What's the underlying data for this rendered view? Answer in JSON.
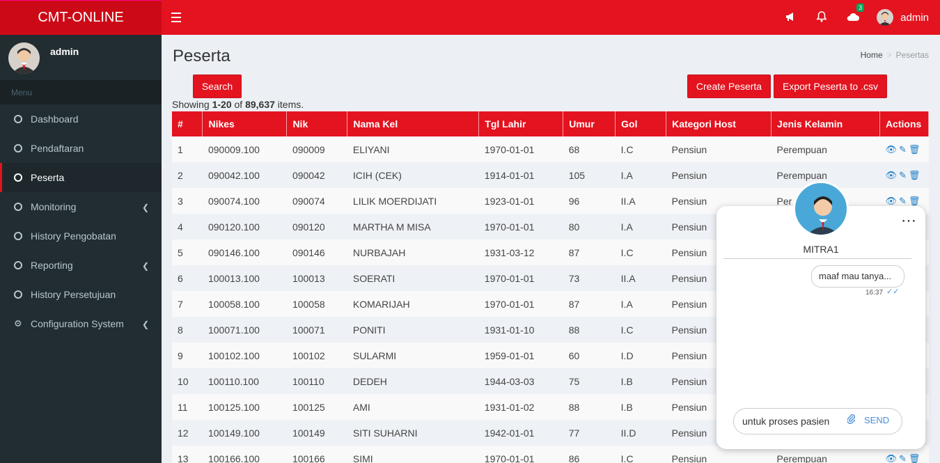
{
  "app": {
    "title": "CMT-ONLINE"
  },
  "topbar": {
    "cloud_badge": "3",
    "username": "admin"
  },
  "sidebar": {
    "username": "admin",
    "menu_header": "Menu",
    "items": [
      {
        "label": "Dashboard"
      },
      {
        "label": "Pendaftaran"
      },
      {
        "label": "Peserta"
      },
      {
        "label": "Monitoring"
      },
      {
        "label": "History Pengobatan"
      },
      {
        "label": "Reporting"
      },
      {
        "label": "History Persetujuan"
      },
      {
        "label": "Configuration System"
      }
    ]
  },
  "page": {
    "title": "Peserta",
    "breadcrumb": {
      "home": "Home",
      "separator": ">",
      "current": "Pesertas"
    },
    "search_button": "Search",
    "create_button": "Create Peserta",
    "export_button": "Export Peserta to .csv",
    "summary": {
      "prefix": "Showing ",
      "range": "1-20",
      "mid": " of ",
      "total": "89,637",
      "suffix": " items."
    }
  },
  "table": {
    "headers": [
      "#",
      "Nikes",
      "Nik",
      "Nama Kel",
      "Tgl Lahir",
      "Umur",
      "Gol",
      "Kategori Host",
      "Jenis Kelamin",
      "Actions"
    ],
    "rows": [
      [
        "1",
        "090009.100",
        "090009",
        "ELIYANI",
        "1970-01-01",
        "68",
        "I.C",
        "Pensiun",
        "Perempuan"
      ],
      [
        "2",
        "090042.100",
        "090042",
        "ICIH (CEK)",
        "1914-01-01",
        "105",
        "I.A",
        "Pensiun",
        "Perempuan"
      ],
      [
        "3",
        "090074.100",
        "090074",
        "LILIK MOERDIJATI",
        "1923-01-01",
        "96",
        "II.A",
        "Pensiun",
        "Per"
      ],
      [
        "4",
        "090120.100",
        "090120",
        "MARTHA M MISA",
        "1970-01-01",
        "80",
        "I.A",
        "Pensiun",
        ""
      ],
      [
        "5",
        "090146.100",
        "090146",
        "NURBAJAH",
        "1931-03-12",
        "87",
        "I.C",
        "Pensiun",
        ""
      ],
      [
        "6",
        "100013.100",
        "100013",
        "SOERATI",
        "1970-01-01",
        "73",
        "II.A",
        "Pensiun",
        ""
      ],
      [
        "7",
        "100058.100",
        "100058",
        "KOMARIJAH",
        "1970-01-01",
        "87",
        "I.A",
        "Pensiun",
        ""
      ],
      [
        "8",
        "100071.100",
        "100071",
        "PONITI",
        "1931-01-10",
        "88",
        "I.C",
        "Pensiun",
        ""
      ],
      [
        "9",
        "100102.100",
        "100102",
        "SULARMI",
        "1959-01-01",
        "60",
        "I.D",
        "Pensiun",
        ""
      ],
      [
        "10",
        "100110.100",
        "100110",
        "DEDEH",
        "1944-03-03",
        "75",
        "I.B",
        "Pensiun",
        ""
      ],
      [
        "11",
        "100125.100",
        "100125",
        "AMI",
        "1931-01-02",
        "88",
        "I.B",
        "Pensiun",
        ""
      ],
      [
        "12",
        "100149.100",
        "100149",
        "SITI SUHARNI",
        "1942-01-01",
        "77",
        "II.D",
        "Pensiun",
        ""
      ],
      [
        "13",
        "100166.100",
        "100166",
        "SIMI",
        "1970-01-01",
        "86",
        "I.C",
        "Pensiun",
        "Perempuan"
      ]
    ]
  },
  "chat": {
    "name": "MITRA1",
    "menu": "⋯",
    "message": "maaf mau tanya...",
    "time": "16:37",
    "input_value": "untuk proses pasien",
    "send_label": "SEND"
  },
  "colors": {
    "brand_red": "#e3131f",
    "brand_dark_red": "#cc0a17",
    "sidebar_bg": "#222d32",
    "action_blue": "#1e80c8"
  }
}
